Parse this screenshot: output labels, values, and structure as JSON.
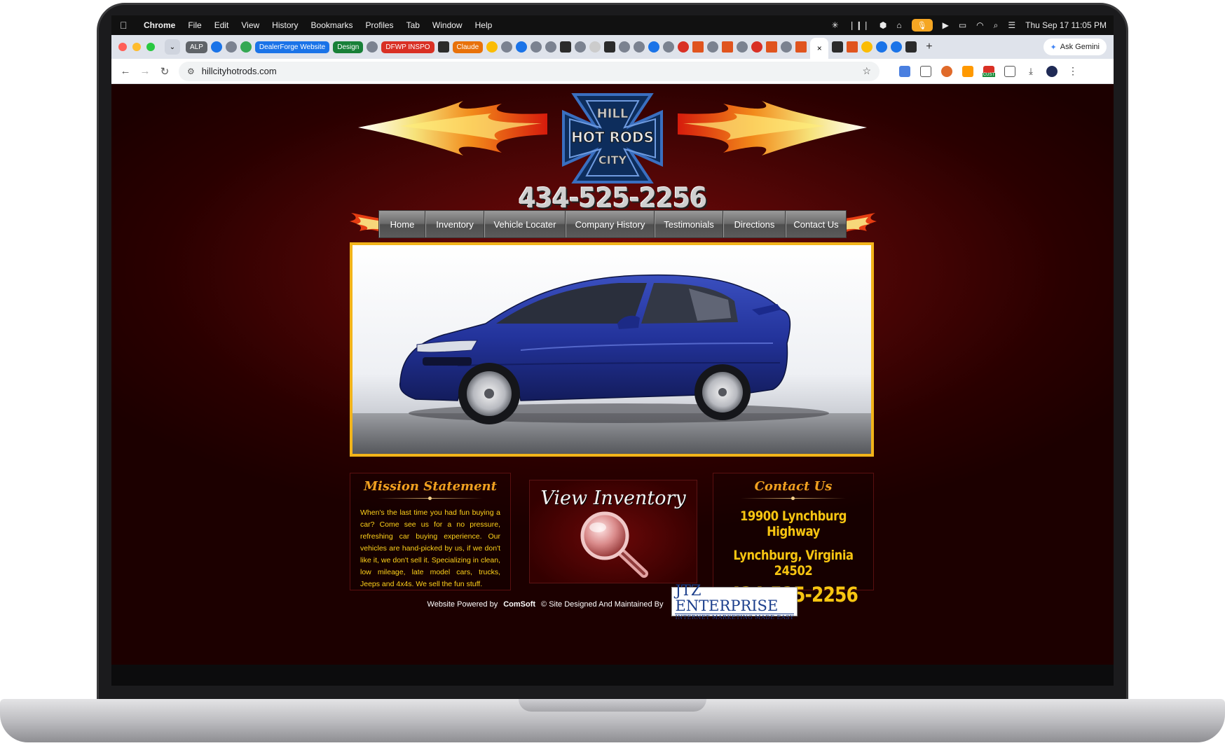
{
  "macos": {
    "app_name": "Chrome",
    "menu": [
      "File",
      "Edit",
      "View",
      "History",
      "Bookmarks",
      "Profiles",
      "Tab",
      "Window",
      "Help"
    ],
    "clock": "Thu Sep 17  11:05 PM"
  },
  "chrome": {
    "tab_groups": [
      {
        "label": "ALP",
        "color": "#5f6368"
      },
      {
        "label": "DealerForge Website",
        "color": "#1a73e8"
      },
      {
        "label": "Design",
        "color": "#188038"
      },
      {
        "label": "DFWP INSPO",
        "color": "#d93025"
      },
      {
        "label": "Claude",
        "color": "#e8710a"
      }
    ],
    "active_tab_close": "×",
    "new_tab": "+",
    "ask_gemini": "Ask Gemini",
    "url": "hillcityhotrods.com",
    "ext_badge": "CUST"
  },
  "site": {
    "logo_text_top": "HILL",
    "logo_text_mid": "HOT RODS",
    "logo_text_bottom": "CITY",
    "phone_header": "434-525-2256",
    "nav": [
      {
        "label": "Home"
      },
      {
        "label": "Inventory"
      },
      {
        "label": "Vehicle Locater"
      },
      {
        "label": "Company History"
      },
      {
        "label": "Testimonials"
      },
      {
        "label": "Directions"
      },
      {
        "label": "Contact Us"
      }
    ],
    "mission": {
      "title": "Mission Statement",
      "body": "When's the last time you had fun buying a car? Come see us for a no pressure, refreshing car buying experience. Our vehicles are hand-picked by us, if we don't like it, we don't sell it. Specializing in clean, low mileage, late model cars, trucks, Jeeps and 4x4s. We sell the fun stuff."
    },
    "view_inventory": "View Inventory",
    "contact": {
      "title": "Contact Us",
      "address": "19900 Lynchburg Highway",
      "city": "Lynchburg, Virginia 24502",
      "phone": "434-525-2256"
    },
    "footer": {
      "prefix": "Website Powered by",
      "brand": "ComSoft",
      "suffix": "© Site Designed And Maintained By",
      "partner_big": "JTZ ENTERPRISE",
      "partner_sub": "INTERNET MARKETING MADE EASY"
    }
  }
}
